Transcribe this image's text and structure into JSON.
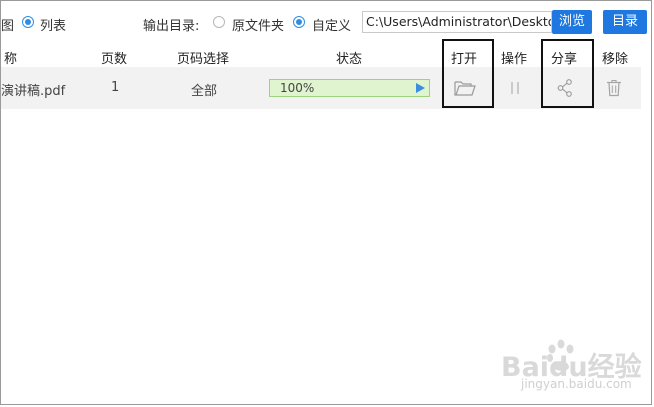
{
  "toolbar": {
    "view_partial": "图",
    "list_label": "列表",
    "output_dir_label": "输出目录:",
    "opt_original": "原文件夹",
    "opt_custom": "自定义",
    "path_value": "C:\\Users\\Administrator\\Desktop",
    "browse_label": "浏览",
    "dir_label": "目录"
  },
  "table": {
    "headers": {
      "name": "称",
      "pages": "页数",
      "page_select": "页码选择",
      "status": "状态",
      "open": "打开",
      "operate": "操作",
      "share": "分享",
      "remove": "移除"
    },
    "rows": [
      {
        "file_name": "演讲稿.pdf",
        "pages": "1",
        "page_select": "全部",
        "progress_text": "100%",
        "progress_value": 100
      }
    ]
  },
  "watermark": {
    "text": "Baidu经验",
    "url": "jingyan.baidu.com"
  },
  "colors": {
    "accent": "#1e78e0",
    "radio_checked": "#2f8de4",
    "progress_fill": "#dff4cf",
    "progress_border": "#9fd27d",
    "row_bg": "#f2f2f2",
    "highlight_border": "#111111"
  }
}
